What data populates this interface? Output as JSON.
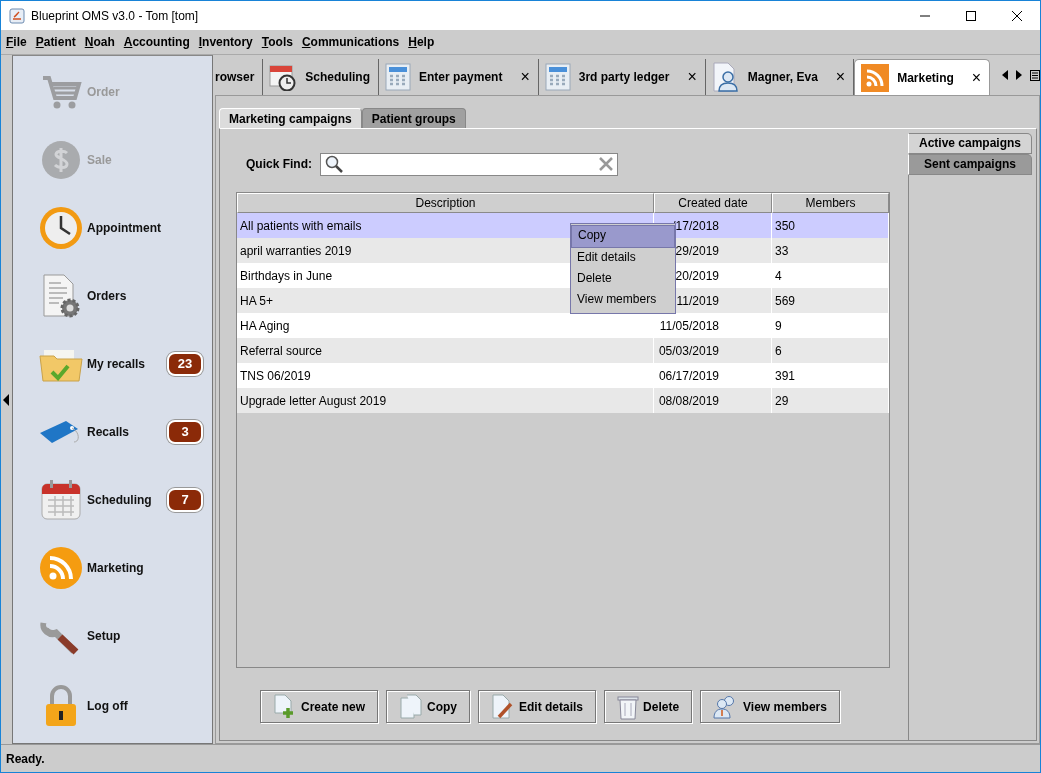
{
  "window": {
    "title": "Blueprint OMS v3.0 - Tom [tom]"
  },
  "menu": [
    "File",
    "Patient",
    "Noah",
    "Accounting",
    "Inventory",
    "Tools",
    "Communications",
    "Help"
  ],
  "sidebar": {
    "items": [
      {
        "label": "Order",
        "disabled": true
      },
      {
        "label": "Sale",
        "disabled": true
      },
      {
        "label": "Appointment",
        "disabled": false
      },
      {
        "label": "Orders",
        "disabled": false
      },
      {
        "label": "My recalls",
        "disabled": false,
        "badge": "23"
      },
      {
        "label": "Recalls",
        "disabled": false,
        "badge": "3"
      },
      {
        "label": "Scheduling",
        "disabled": false,
        "badge": "7"
      },
      {
        "label": "Marketing",
        "disabled": false
      },
      {
        "label": "Setup",
        "disabled": false
      },
      {
        "label": "Log off",
        "disabled": false
      }
    ]
  },
  "tabs": [
    {
      "label": "rowser",
      "selected": false
    },
    {
      "label": "Scheduling",
      "selected": false
    },
    {
      "label": "Enter payment",
      "close": "×",
      "selected": false
    },
    {
      "label": "3rd party ledger",
      "close": "×",
      "selected": false
    },
    {
      "label": "Magner, Eva",
      "close": "×",
      "selected": false
    },
    {
      "label": "Marketing",
      "close": "×",
      "selected": true
    }
  ],
  "subtabs": [
    {
      "label": "Marketing campaigns",
      "selected": true
    },
    {
      "label": "Patient groups",
      "selected": false
    }
  ],
  "side_tabs": [
    {
      "label": "Active campaigns",
      "selected": true
    },
    {
      "label": "Sent campaigns",
      "selected": false
    }
  ],
  "quick_find": {
    "label": "Quick Find:"
  },
  "table": {
    "columns": [
      "Description",
      "Created date",
      "Members"
    ],
    "rows": [
      {
        "description": "All patients with emails",
        "created": "/17/2018",
        "members": "350",
        "selected": true
      },
      {
        "description": "april warranties 2019",
        "created": "29/2019",
        "members": "33",
        "selected": false
      },
      {
        "description": "Birthdays in June",
        "created": "20/2019",
        "members": "4",
        "selected": false
      },
      {
        "description": "HA 5+",
        "created": "11/2019",
        "members": "569",
        "selected": false
      },
      {
        "description": "HA Aging",
        "created": "11/05/2018",
        "members": "9",
        "selected": false
      },
      {
        "description": "Referral source",
        "created": "05/03/2019",
        "members": "6",
        "selected": false
      },
      {
        "description": "TNS 06/2019",
        "created": "06/17/2019",
        "members": "391",
        "selected": false
      },
      {
        "description": "Upgrade letter August 2019",
        "created": "08/08/2019",
        "members": "29",
        "selected": false
      }
    ]
  },
  "context_menu": {
    "items": [
      {
        "label": "Copy",
        "selected": true
      },
      {
        "label": "Edit details",
        "selected": false
      },
      {
        "label": "Delete",
        "selected": false
      },
      {
        "label": "View members",
        "selected": false
      }
    ]
  },
  "buttons": [
    "Create new",
    "Copy",
    "Edit details",
    "Delete",
    "View members"
  ],
  "status_bar": "Ready."
}
